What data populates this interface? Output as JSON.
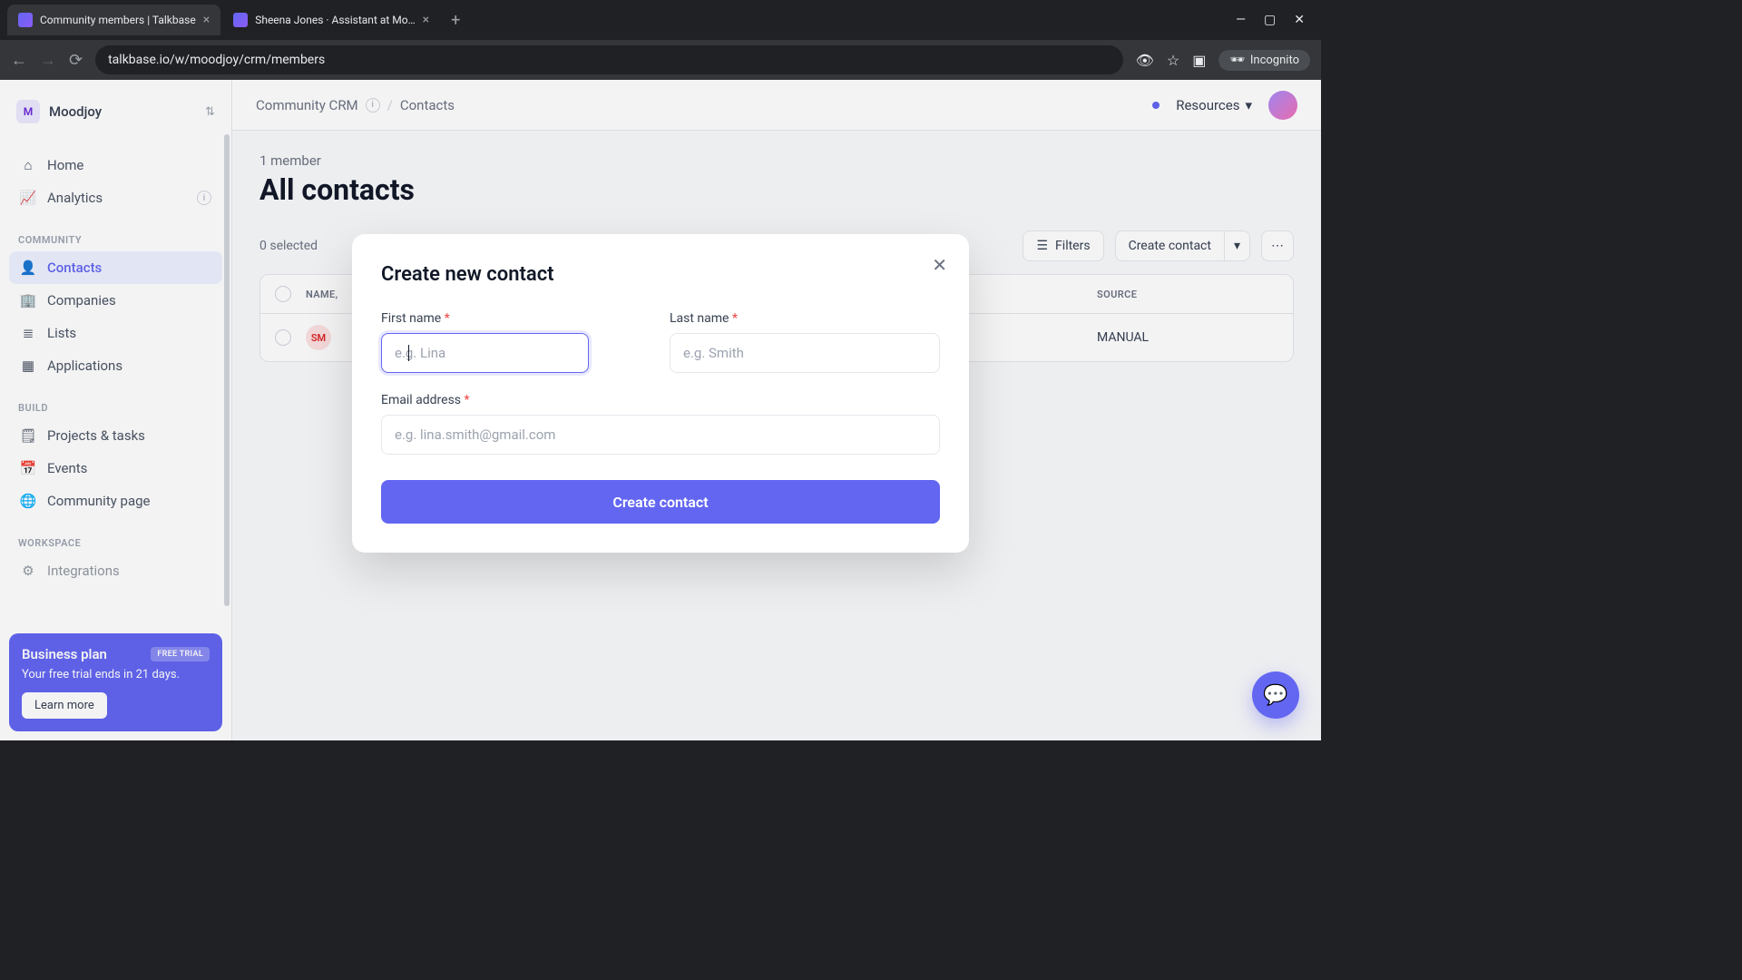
{
  "browser": {
    "tabs": [
      {
        "title": "Community members | Talkbase"
      },
      {
        "title": "Sheena Jones · Assistant at Mo…"
      }
    ],
    "url": "talkbase.io/w/moodjoy/crm/members",
    "incognito": "Incognito"
  },
  "workspace": {
    "initial": "M",
    "name": "Moodjoy"
  },
  "nav": {
    "home": "Home",
    "analytics": "Analytics",
    "section_community": "COMMUNITY",
    "contacts": "Contacts",
    "companies": "Companies",
    "lists": "Lists",
    "applications": "Applications",
    "section_build": "BUILD",
    "projects": "Projects & tasks",
    "events": "Events",
    "community_page": "Community page",
    "section_workspace": "WORKSPACE",
    "integrations": "Integrations"
  },
  "promo": {
    "title": "Business plan",
    "badge": "FREE TRIAL",
    "text": "Your free trial ends in 21 days.",
    "cta": "Learn more"
  },
  "breadcrumb": {
    "root": "Community CRM",
    "leaf": "Contacts"
  },
  "topbar": {
    "resources": "Resources"
  },
  "page": {
    "count": "1 member",
    "title": "All contacts",
    "selected": "0 selected",
    "filters": "Filters",
    "create": "Create contact"
  },
  "table": {
    "col_name": "NAME,",
    "col_source": "SOURCE",
    "row_badge": "SM",
    "row_source": "MANUAL"
  },
  "modal": {
    "title": "Create new contact",
    "first_name_label": "First name",
    "first_name_ph": "e.g. Lina",
    "last_name_label": "Last name",
    "last_name_ph": "e.g. Smith",
    "email_label": "Email address",
    "email_ph": "e.g. lina.smith@gmail.com",
    "submit": "Create contact"
  }
}
